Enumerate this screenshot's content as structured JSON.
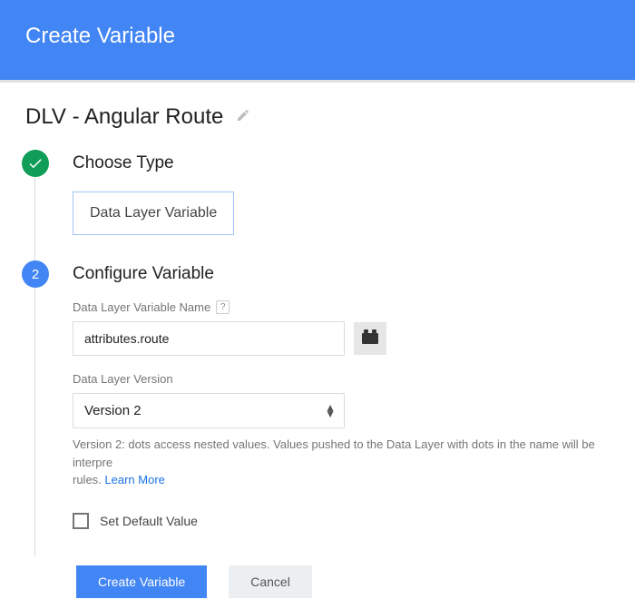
{
  "header": {
    "title": "Create Variable"
  },
  "variable": {
    "name": "DLV - Angular Route"
  },
  "steps": {
    "step1": {
      "title": "Choose Type",
      "selected_type": "Data Layer Variable"
    },
    "step2": {
      "number": "2",
      "title": "Configure Variable",
      "name_field": {
        "label": "Data Layer Variable Name",
        "help_badge": "?",
        "value": "attributes.route"
      },
      "version_field": {
        "label": "Data Layer Version",
        "value": "Version 2",
        "help_text_prefix": "Version 2: dots access nested values. Values pushed to the Data Layer with dots in the name will be interpre",
        "help_text_suffix": "rules. ",
        "learn_more": "Learn More"
      },
      "default_checkbox": {
        "label": "Set Default Value",
        "checked": false
      }
    }
  },
  "actions": {
    "primary": "Create Variable",
    "secondary": "Cancel"
  }
}
